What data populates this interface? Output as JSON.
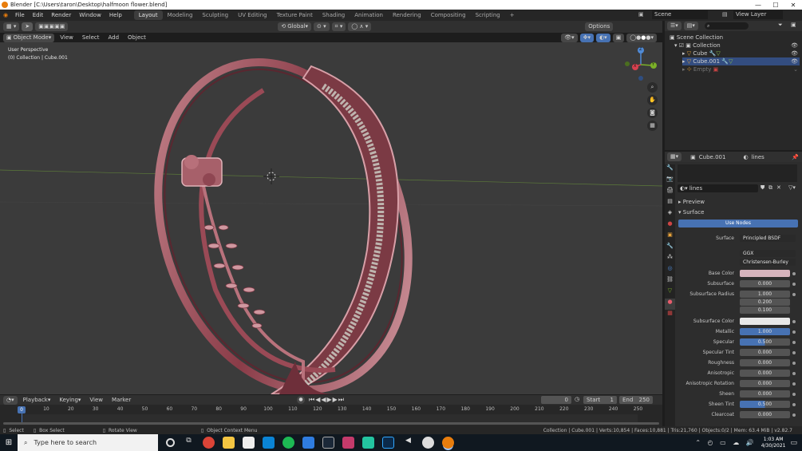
{
  "window": {
    "title": "Blender [C:\\Users\\taron\\Desktop\\halfmoon flower.blend]",
    "controls": [
      "—",
      "☐",
      "✕"
    ]
  },
  "menu": {
    "items": [
      "File",
      "Edit",
      "Render",
      "Window",
      "Help"
    ],
    "workspaces": [
      "Layout",
      "Modeling",
      "Sculpting",
      "UV Editing",
      "Texture Paint",
      "Shading",
      "Animation",
      "Rendering",
      "Compositing",
      "Scripting"
    ],
    "active_workspace": "Layout",
    "add_tab": "+",
    "scene": "Scene",
    "view_layer": "View Layer"
  },
  "viewport": {
    "mode": "Object Mode",
    "menus": [
      "View",
      "Select",
      "Add",
      "Object"
    ],
    "transform": "Global",
    "options": "Options",
    "overlay_title": "User Perspective",
    "overlay_sub": "(0) Collection | Cube.001",
    "axes": {
      "x": "X",
      "y": "Y",
      "z": "Z"
    }
  },
  "outliner": {
    "root": "Scene Collection",
    "collection": "Collection",
    "items": [
      "Cube",
      "Cube.001",
      "Empty"
    ]
  },
  "properties": {
    "object": "Cube.001",
    "material_slot": "lines",
    "material_name": "lines",
    "preview": "Preview",
    "surface_section": "Surface",
    "use_nodes": "Use Nodes",
    "surface_label": "Surface",
    "surface_value": "Principled BSDF",
    "distribution": "GGX",
    "subsurface_method": "Christensen-Burley",
    "fields": [
      {
        "label": "Base Color",
        "value": "",
        "color": "#d6b3bc"
      },
      {
        "label": "Subsurface",
        "value": "0.000"
      },
      {
        "label": "Subsurface Radius",
        "value": "1.000"
      },
      {
        "label": "",
        "value": "0.200"
      },
      {
        "label": "",
        "value": "0.100"
      },
      {
        "label": "Subsurface Color",
        "value": "",
        "color": "#e8e8e8"
      },
      {
        "label": "Metallic",
        "value": "1.000",
        "fill": 1.0
      },
      {
        "label": "Specular",
        "value": "0.500",
        "fill": 0.5
      },
      {
        "label": "Specular Tint",
        "value": "0.000"
      },
      {
        "label": "Roughness",
        "value": "0.000"
      },
      {
        "label": "Anisotropic",
        "value": "0.000"
      },
      {
        "label": "Anisotropic Rotation",
        "value": "0.000"
      },
      {
        "label": "Sheen",
        "value": "0.000"
      },
      {
        "label": "Sheen Tint",
        "value": "0.500",
        "fill": 0.5
      },
      {
        "label": "Clearcoat",
        "value": "0.000"
      }
    ]
  },
  "timeline": {
    "menus": [
      "Playback",
      "Keying",
      "View",
      "Marker"
    ],
    "current_frame": "0",
    "start_label": "Start",
    "start": "1",
    "end_label": "End",
    "end": "250",
    "ticks": [
      "0",
      "10",
      "20",
      "30",
      "40",
      "50",
      "60",
      "70",
      "80",
      "90",
      "100",
      "110",
      "120",
      "130",
      "140",
      "150",
      "160",
      "170",
      "180",
      "190",
      "200",
      "210",
      "220",
      "230",
      "240",
      "250"
    ],
    "playhead": "0"
  },
  "status": {
    "select": "Select",
    "box_select": "Box Select",
    "rotate": "Rotate View",
    "context": "Object Context Menu",
    "stats": "Collection | Cube.001 | Verts:10,854 | Faces:10,881 | Tris:21,760 | Objects:0/2 | Mem: 63.4 MiB | v2.82.7"
  },
  "taskbar": {
    "search": "Type here to search",
    "time": "1:03 AM",
    "date": "4/30/2021"
  }
}
